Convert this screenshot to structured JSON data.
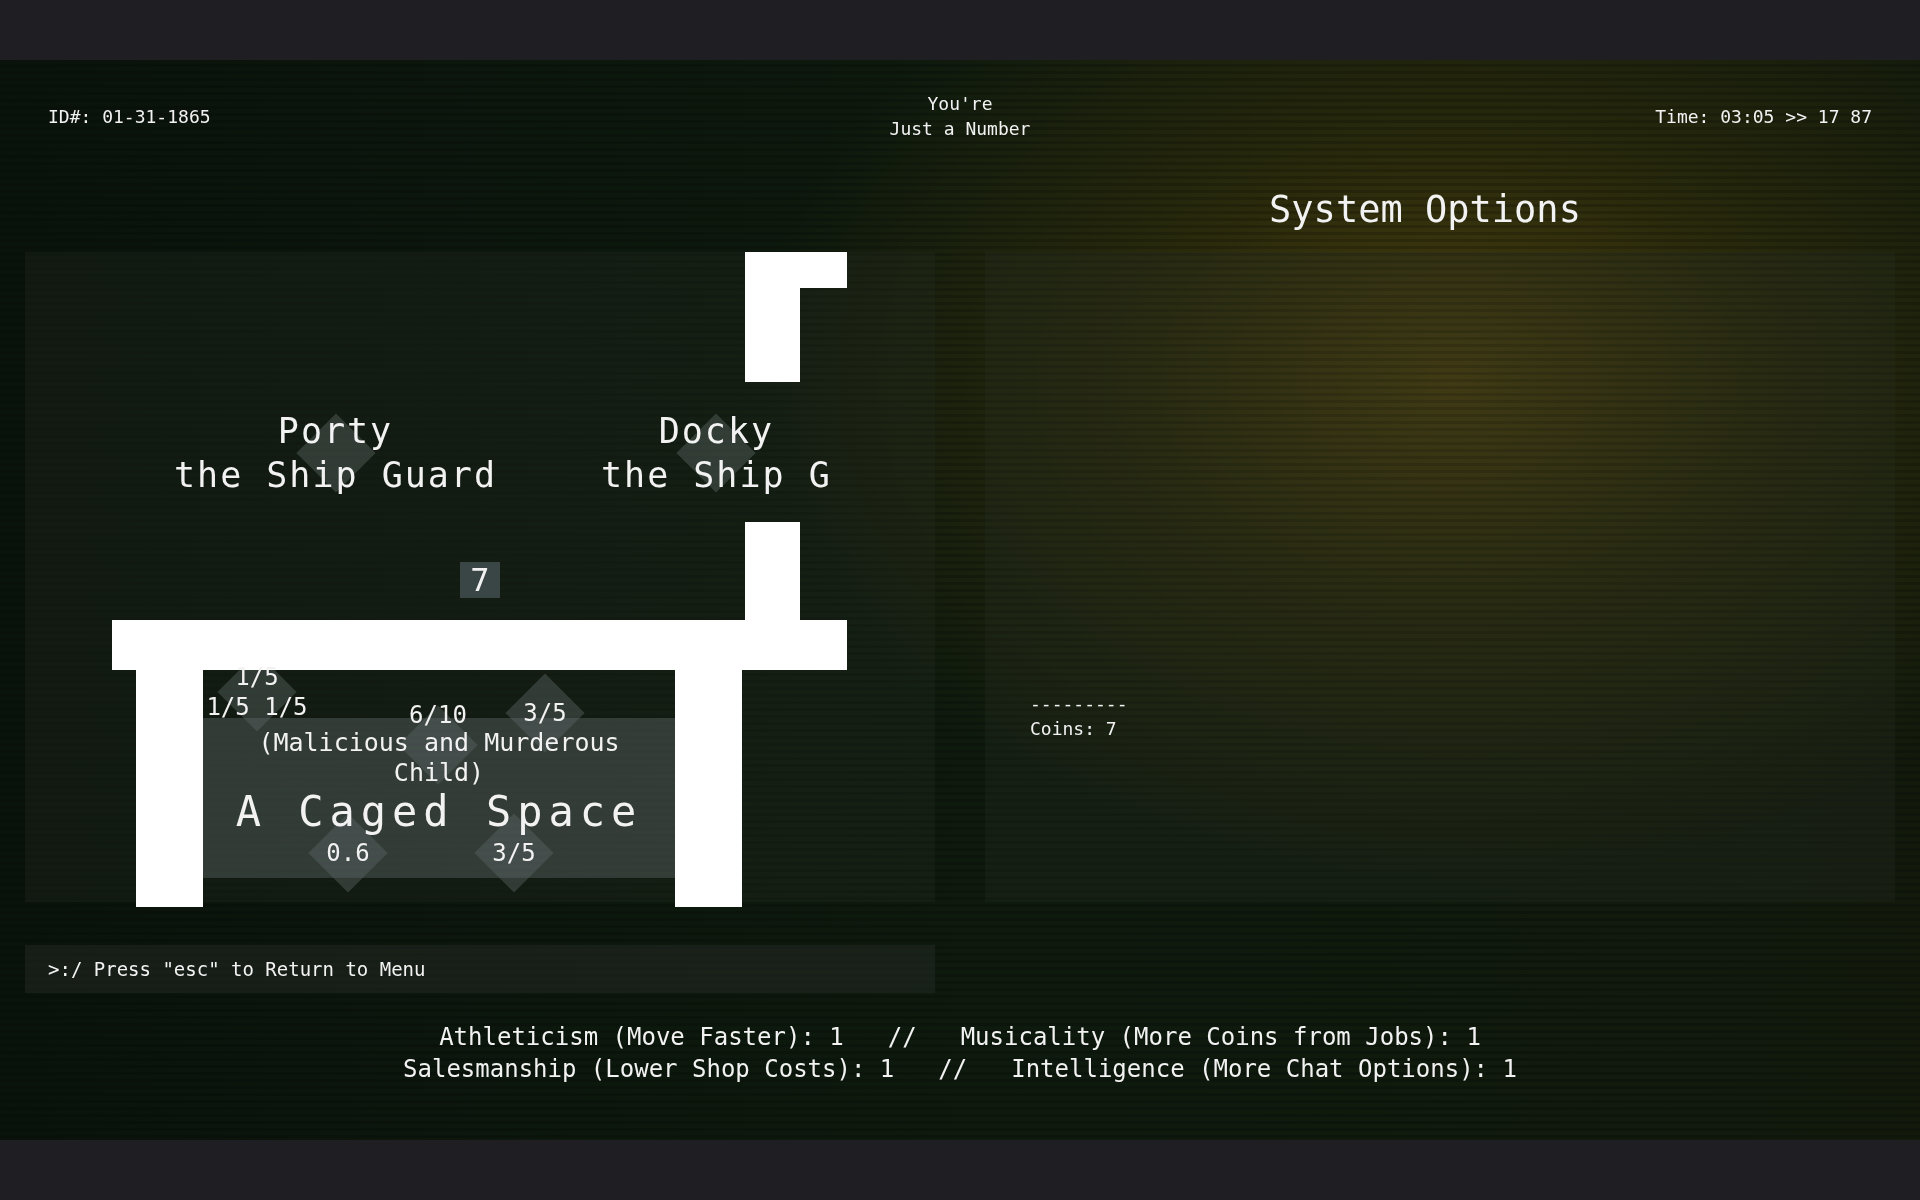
{
  "header": {
    "id_label": "ID#: 01-31-1865",
    "title_lines": [
      "You're",
      "Just a Number"
    ],
    "time": "Time: 03:05 >> 17 87"
  },
  "system_options": {
    "title": "System Options",
    "separator": "---------",
    "coins": "Coins: 7"
  },
  "map": {
    "npcs": [
      {
        "name": "Porty",
        "role": "the Ship Guard"
      },
      {
        "name": "Docky",
        "role": "the Ship G"
      }
    ],
    "counter": "7",
    "labels": [
      "1/5",
      "1/5 1/5",
      "6/10",
      "3/5",
      "0.6",
      "3/5"
    ],
    "room": {
      "subtitle_lines": [
        "(Malicious and Murderous",
        "Child)"
      ],
      "name": "A Caged Space"
    }
  },
  "command_line": ">:/ Press \"esc\" to Return to Menu",
  "stats": [
    [
      "Athleticism (Move Faster): 1",
      "//",
      "Musicality (More Coins from Jobs): 1"
    ],
    [
      "Salesmanship (Lower Shop Costs): 1",
      "//",
      "Intelligence (More Chat Options): 1"
    ]
  ]
}
